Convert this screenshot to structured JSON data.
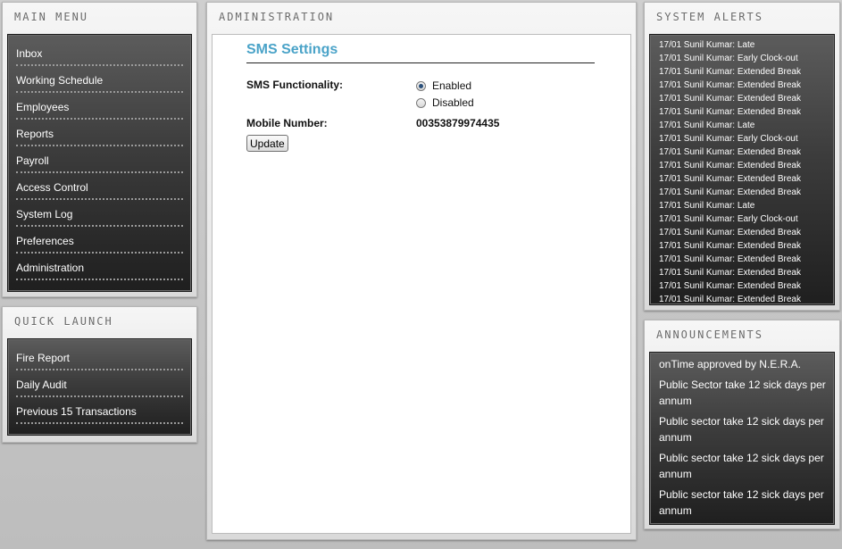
{
  "main_menu": {
    "title": "MAIN MENU",
    "items": [
      {
        "label": "Inbox"
      },
      {
        "label": "Working Schedule"
      },
      {
        "label": "Employees"
      },
      {
        "label": "Reports"
      },
      {
        "label": "Payroll"
      },
      {
        "label": "Access Control"
      },
      {
        "label": "System Log"
      },
      {
        "label": "Preferences"
      },
      {
        "label": "Administration"
      }
    ]
  },
  "quick_launch": {
    "title": "QUICK LAUNCH",
    "items": [
      {
        "label": "Fire Report"
      },
      {
        "label": "Daily Audit"
      },
      {
        "label": "Previous 15 Transactions"
      }
    ]
  },
  "administration": {
    "title": "ADMINISTRATION",
    "sms_title": "SMS Settings",
    "sms_functionality_label": "SMS Functionality:",
    "options": [
      {
        "label": "Enabled",
        "checked": true
      },
      {
        "label": "Disabled",
        "checked": false
      }
    ],
    "mobile_label": "Mobile Number:",
    "mobile_value": "00353879974435",
    "update_label": "Update"
  },
  "system_alerts": {
    "title": "SYSTEM ALERTS",
    "items": [
      "17/01 Sunil Kumar: Late",
      "17/01 Sunil Kumar: Early Clock-out",
      "17/01 Sunil Kumar: Extended Break",
      "17/01 Sunil Kumar: Extended Break",
      "17/01 Sunil Kumar: Extended Break",
      "17/01 Sunil Kumar: Extended Break",
      "17/01 Sunil Kumar: Late",
      "17/01 Sunil Kumar: Early Clock-out",
      "17/01 Sunil Kumar: Extended Break",
      "17/01 Sunil Kumar: Extended Break",
      "17/01 Sunil Kumar: Extended Break",
      "17/01 Sunil Kumar: Extended Break",
      "17/01 Sunil Kumar: Late",
      "17/01 Sunil Kumar: Early Clock-out",
      "17/01 Sunil Kumar: Extended Break",
      "17/01 Sunil Kumar: Extended Break",
      "17/01 Sunil Kumar: Extended Break",
      "17/01 Sunil Kumar: Extended Break",
      "17/01 Sunil Kumar: Extended Break",
      "17/01 Sunil Kumar: Extended Break"
    ]
  },
  "announcements": {
    "title": "ANNOUNCEMENTS",
    "items": [
      "onTime approved by N.E.R.A.",
      "Public Sector take 12 sick days per annum",
      "Public sector take 12 sick days per annum",
      "Public sector take 12 sick days per annum",
      "Public sector take 12 sick days per annum"
    ]
  },
  "colors": {
    "accent": "#4aa3c8",
    "panel_dark": "#2e2e2e",
    "page_bg": "#c4c4c4"
  }
}
